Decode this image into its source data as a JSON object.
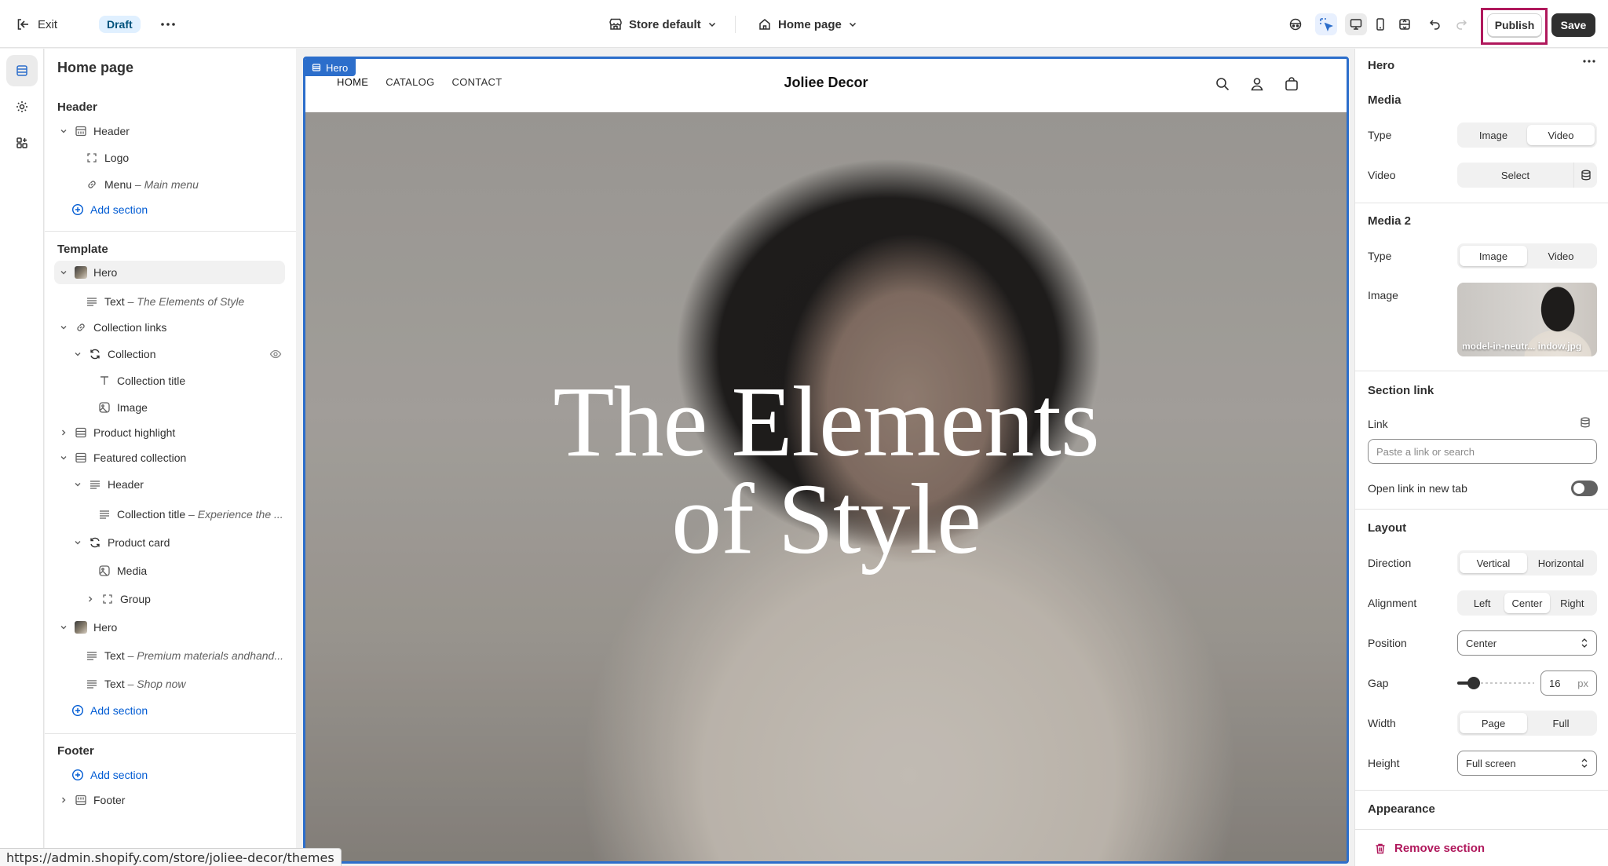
{
  "topbar": {
    "exit_label": "Exit",
    "status_badge": "Draft",
    "store_selector": "Store default",
    "page_selector": "Home page",
    "publish_label": "Publish",
    "save_label": "Save"
  },
  "left_panel": {
    "title": "Home page",
    "groups": {
      "header": "Header",
      "template": "Template",
      "footer": "Footer"
    },
    "rows": {
      "header_header": "Header",
      "logo": "Logo",
      "menu": "Menu",
      "menu_sub": "Main menu",
      "add_section_1": "Add section",
      "hero_1": "Hero",
      "text_1": "Text",
      "text_1_sub": "The Elements of Style",
      "collection_links": "Collection links",
      "collection": "Collection",
      "collection_title": "Collection title",
      "image": "Image",
      "product_highlight": "Product highlight",
      "featured_collection": "Featured collection",
      "fc_header": "Header",
      "fc_collection_title": "Collection title",
      "fc_collection_title_sub": "Experience the ...",
      "product_card": "Product card",
      "media": "Media",
      "group": "Group",
      "hero_2": "Hero",
      "text_2": "Text",
      "text_2_sub": "Premium materials andhand...",
      "text_3": "Text",
      "text_3_sub": "Shop now",
      "add_section_2": "Add section",
      "add_section_3": "Add section",
      "footer": "Footer"
    }
  },
  "canvas": {
    "section_tag": "Hero",
    "nav": [
      "HOME",
      "CATALOG",
      "CONTACT"
    ],
    "brand": "Joliee Decor",
    "hero_line1": "The Elements",
    "hero_line2": "of Style"
  },
  "right_panel": {
    "title": "Hero",
    "media": {
      "section": "Media",
      "type_label": "Type",
      "type_options": [
        "Image",
        "Video"
      ],
      "video_label": "Video",
      "select_label": "Select"
    },
    "media2": {
      "section": "Media 2",
      "type_label": "Type",
      "type_options": [
        "Image",
        "Video"
      ],
      "image_label": "Image",
      "image_caption": "model-in-neutr... indow.jpg"
    },
    "section_link": {
      "section": "Section link",
      "link_label": "Link",
      "link_placeholder": "Paste a link or search",
      "new_tab_label": "Open link in new tab"
    },
    "layout": {
      "section": "Layout",
      "direction_label": "Direction",
      "direction_options": [
        "Vertical",
        "Horizontal"
      ],
      "alignment_label": "Alignment",
      "alignment_options": [
        "Left",
        "Center",
        "Right"
      ],
      "position_label": "Position",
      "position_value": "Center",
      "gap_label": "Gap",
      "gap_value": "16",
      "gap_unit": "px",
      "gap_slider_fraction": 0.16,
      "width_label": "Width",
      "width_options": [
        "Page",
        "Full"
      ],
      "height_label": "Height",
      "height_value": "Full screen"
    },
    "appearance": {
      "section": "Appearance"
    },
    "remove_label": "Remove section"
  },
  "status_url": "https://admin.shopify.com/store/joliee-decor/themes",
  "colors": {
    "accent_blue": "#2c6ecb",
    "publish_outline": "#b0185c",
    "remove_red": "#b0185c"
  }
}
